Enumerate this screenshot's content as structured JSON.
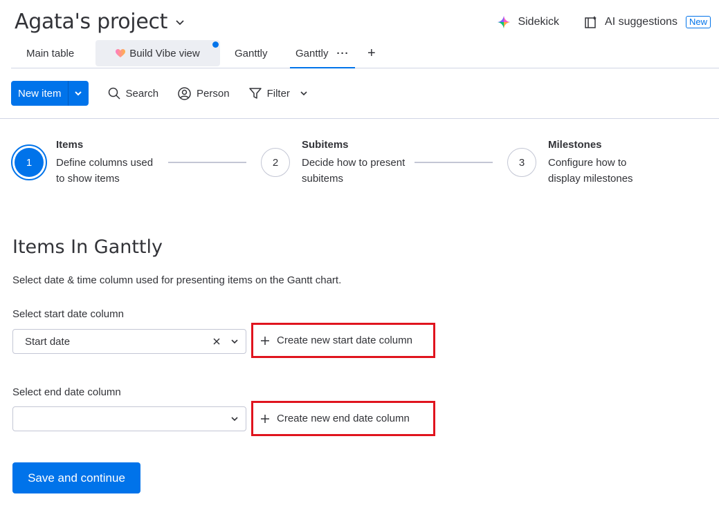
{
  "header": {
    "project_title": "Agata's project",
    "sidekick_label": "Sidekick",
    "ai_suggestions_label": "AI suggestions",
    "new_badge": "New"
  },
  "tabs": [
    {
      "label": "Main table"
    },
    {
      "label": "Build Vibe view"
    },
    {
      "label": "Ganttly"
    },
    {
      "label": "Ganttly",
      "active": true
    }
  ],
  "toolbar": {
    "new_item_label": "New item",
    "search_label": "Search",
    "person_label": "Person",
    "filter_label": "Filter"
  },
  "stepper": [
    {
      "number": "1",
      "title": "Items",
      "desc": "Define columns used to show items",
      "active": true
    },
    {
      "number": "2",
      "title": "Subitems",
      "desc": "Decide how to present subitems"
    },
    {
      "number": "3",
      "title": "Milestones",
      "desc": "Configure how to display milestones"
    }
  ],
  "section": {
    "title": "Items In Ganttly",
    "description": "Select date & time column used for presenting items on the Gantt chart."
  },
  "start_field": {
    "label": "Select start date column",
    "value": "Start date",
    "create_label": "Create new start date column"
  },
  "end_field": {
    "label": "Select end date column",
    "value": "",
    "create_label": "Create new end date column"
  },
  "save_label": "Save and continue",
  "colors": {
    "accent": "#0073ea",
    "highlight": "#e0141e"
  }
}
